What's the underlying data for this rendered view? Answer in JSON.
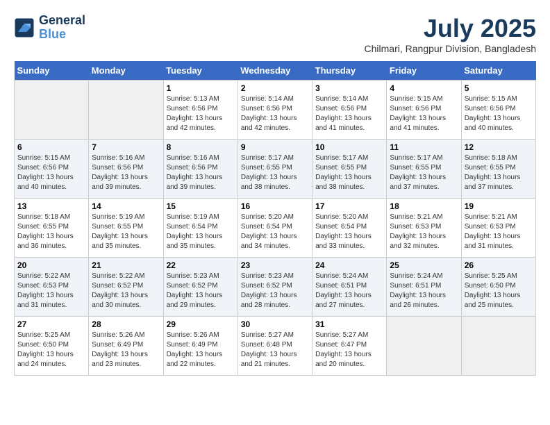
{
  "header": {
    "logo_line1": "General",
    "logo_line2": "Blue",
    "main_title": "July 2025",
    "subtitle": "Chilmari, Rangpur Division, Bangladesh"
  },
  "days_of_week": [
    "Sunday",
    "Monday",
    "Tuesday",
    "Wednesday",
    "Thursday",
    "Friday",
    "Saturday"
  ],
  "weeks": [
    [
      {
        "day": "",
        "info": ""
      },
      {
        "day": "",
        "info": ""
      },
      {
        "day": "1",
        "info": "Sunrise: 5:13 AM\nSunset: 6:56 PM\nDaylight: 13 hours and 42 minutes."
      },
      {
        "day": "2",
        "info": "Sunrise: 5:14 AM\nSunset: 6:56 PM\nDaylight: 13 hours and 42 minutes."
      },
      {
        "day": "3",
        "info": "Sunrise: 5:14 AM\nSunset: 6:56 PM\nDaylight: 13 hours and 41 minutes."
      },
      {
        "day": "4",
        "info": "Sunrise: 5:15 AM\nSunset: 6:56 PM\nDaylight: 13 hours and 41 minutes."
      },
      {
        "day": "5",
        "info": "Sunrise: 5:15 AM\nSunset: 6:56 PM\nDaylight: 13 hours and 40 minutes."
      }
    ],
    [
      {
        "day": "6",
        "info": "Sunrise: 5:15 AM\nSunset: 6:56 PM\nDaylight: 13 hours and 40 minutes."
      },
      {
        "day": "7",
        "info": "Sunrise: 5:16 AM\nSunset: 6:56 PM\nDaylight: 13 hours and 39 minutes."
      },
      {
        "day": "8",
        "info": "Sunrise: 5:16 AM\nSunset: 6:56 PM\nDaylight: 13 hours and 39 minutes."
      },
      {
        "day": "9",
        "info": "Sunrise: 5:17 AM\nSunset: 6:55 PM\nDaylight: 13 hours and 38 minutes."
      },
      {
        "day": "10",
        "info": "Sunrise: 5:17 AM\nSunset: 6:55 PM\nDaylight: 13 hours and 38 minutes."
      },
      {
        "day": "11",
        "info": "Sunrise: 5:17 AM\nSunset: 6:55 PM\nDaylight: 13 hours and 37 minutes."
      },
      {
        "day": "12",
        "info": "Sunrise: 5:18 AM\nSunset: 6:55 PM\nDaylight: 13 hours and 37 minutes."
      }
    ],
    [
      {
        "day": "13",
        "info": "Sunrise: 5:18 AM\nSunset: 6:55 PM\nDaylight: 13 hours and 36 minutes."
      },
      {
        "day": "14",
        "info": "Sunrise: 5:19 AM\nSunset: 6:55 PM\nDaylight: 13 hours and 35 minutes."
      },
      {
        "day": "15",
        "info": "Sunrise: 5:19 AM\nSunset: 6:54 PM\nDaylight: 13 hours and 35 minutes."
      },
      {
        "day": "16",
        "info": "Sunrise: 5:20 AM\nSunset: 6:54 PM\nDaylight: 13 hours and 34 minutes."
      },
      {
        "day": "17",
        "info": "Sunrise: 5:20 AM\nSunset: 6:54 PM\nDaylight: 13 hours and 33 minutes."
      },
      {
        "day": "18",
        "info": "Sunrise: 5:21 AM\nSunset: 6:53 PM\nDaylight: 13 hours and 32 minutes."
      },
      {
        "day": "19",
        "info": "Sunrise: 5:21 AM\nSunset: 6:53 PM\nDaylight: 13 hours and 31 minutes."
      }
    ],
    [
      {
        "day": "20",
        "info": "Sunrise: 5:22 AM\nSunset: 6:53 PM\nDaylight: 13 hours and 31 minutes."
      },
      {
        "day": "21",
        "info": "Sunrise: 5:22 AM\nSunset: 6:52 PM\nDaylight: 13 hours and 30 minutes."
      },
      {
        "day": "22",
        "info": "Sunrise: 5:23 AM\nSunset: 6:52 PM\nDaylight: 13 hours and 29 minutes."
      },
      {
        "day": "23",
        "info": "Sunrise: 5:23 AM\nSunset: 6:52 PM\nDaylight: 13 hours and 28 minutes."
      },
      {
        "day": "24",
        "info": "Sunrise: 5:24 AM\nSunset: 6:51 PM\nDaylight: 13 hours and 27 minutes."
      },
      {
        "day": "25",
        "info": "Sunrise: 5:24 AM\nSunset: 6:51 PM\nDaylight: 13 hours and 26 minutes."
      },
      {
        "day": "26",
        "info": "Sunrise: 5:25 AM\nSunset: 6:50 PM\nDaylight: 13 hours and 25 minutes."
      }
    ],
    [
      {
        "day": "27",
        "info": "Sunrise: 5:25 AM\nSunset: 6:50 PM\nDaylight: 13 hours and 24 minutes."
      },
      {
        "day": "28",
        "info": "Sunrise: 5:26 AM\nSunset: 6:49 PM\nDaylight: 13 hours and 23 minutes."
      },
      {
        "day": "29",
        "info": "Sunrise: 5:26 AM\nSunset: 6:49 PM\nDaylight: 13 hours and 22 minutes."
      },
      {
        "day": "30",
        "info": "Sunrise: 5:27 AM\nSunset: 6:48 PM\nDaylight: 13 hours and 21 minutes."
      },
      {
        "day": "31",
        "info": "Sunrise: 5:27 AM\nSunset: 6:47 PM\nDaylight: 13 hours and 20 minutes."
      },
      {
        "day": "",
        "info": ""
      },
      {
        "day": "",
        "info": ""
      }
    ]
  ]
}
